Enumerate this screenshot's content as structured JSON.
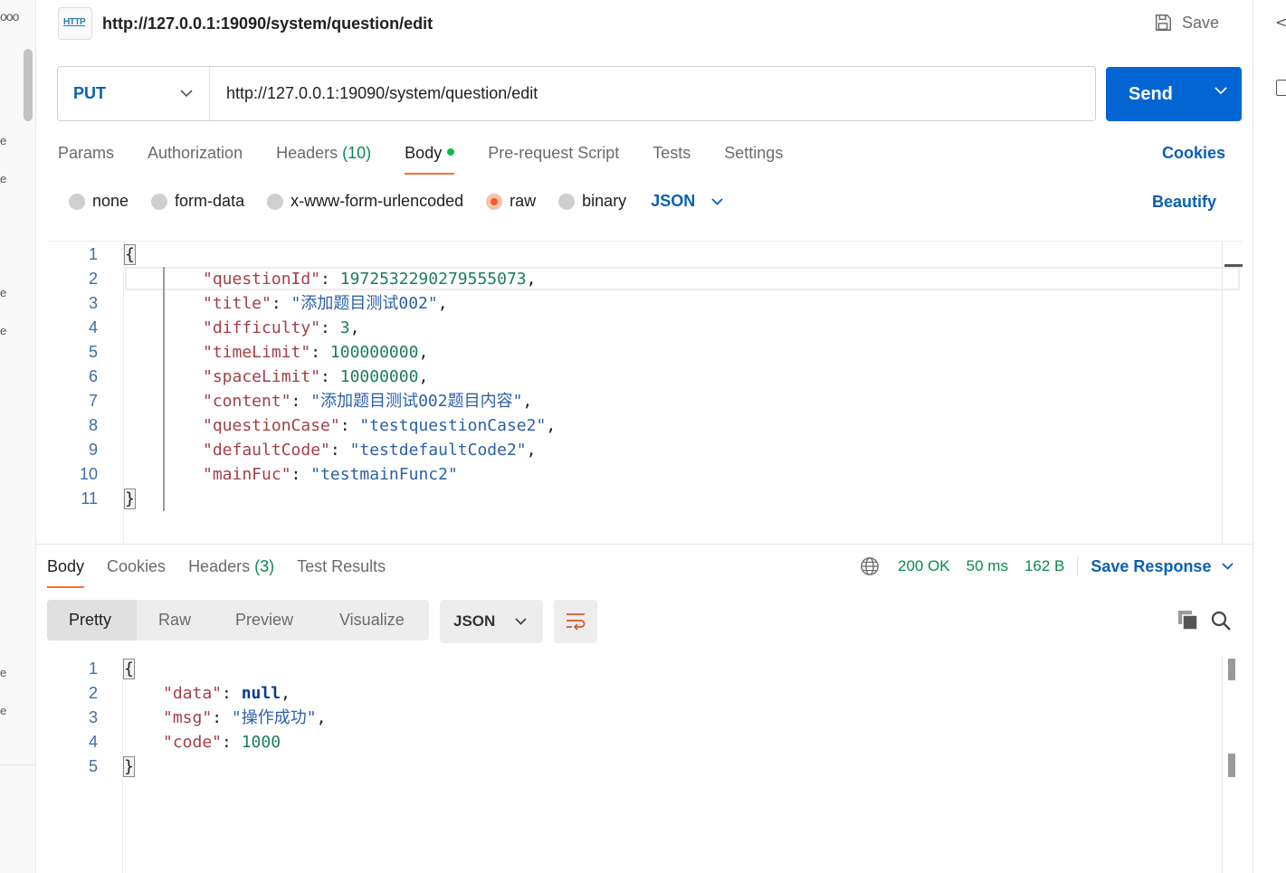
{
  "header": {
    "badge": "HTTP",
    "title": "http://127.0.0.1:19090/system/question/edit",
    "save_label": "Save"
  },
  "request": {
    "method": "PUT",
    "url": "http://127.0.0.1:19090/system/question/edit",
    "send_label": "Send"
  },
  "tabs": {
    "params": "Params",
    "authorization": "Authorization",
    "headers": "Headers",
    "headers_count": "(10)",
    "body": "Body",
    "prerequest": "Pre-request Script",
    "tests": "Tests",
    "settings": "Settings",
    "cookies": "Cookies"
  },
  "body_types": {
    "none": "none",
    "form_data": "form-data",
    "urlencoded": "x-www-form-urlencoded",
    "raw": "raw",
    "binary": "binary",
    "selected": "raw",
    "language": "JSON",
    "beautify": "Beautify"
  },
  "request_body": {
    "line_numbers": [
      "1",
      "2",
      "3",
      "4",
      "5",
      "6",
      "7",
      "8",
      "9",
      "10",
      "11"
    ],
    "open_brace": "{",
    "close_brace": "}",
    "fields": [
      {
        "key": "\"questionId\"",
        "value": "1972532290279555073",
        "kind": "n",
        "comma": ","
      },
      {
        "key": "\"title\"",
        "value": "\"添加题目测试002\"",
        "kind": "s",
        "comma": ","
      },
      {
        "key": "\"difficulty\"",
        "value": "3",
        "kind": "n",
        "comma": ","
      },
      {
        "key": "\"timeLimit\"",
        "value": "100000000",
        "kind": "n",
        "comma": ","
      },
      {
        "key": "\"spaceLimit\"",
        "value": "10000000",
        "kind": "n",
        "comma": ","
      },
      {
        "key": "\"content\"",
        "value": "\"添加题目测试002题目内容\"",
        "kind": "s",
        "comma": ","
      },
      {
        "key": "\"questionCase\"",
        "value": "\"testquestionCase2\"",
        "kind": "s",
        "comma": ","
      },
      {
        "key": "\"defaultCode\"",
        "value": "\"testdefaultCode2\"",
        "kind": "s",
        "comma": ","
      },
      {
        "key": "\"mainFuc\"",
        "value": "\"testmainFunc2\"",
        "kind": "s",
        "comma": ""
      }
    ]
  },
  "response": {
    "tabs": {
      "body": "Body",
      "cookies": "Cookies",
      "headers": "Headers",
      "headers_count": "(3)",
      "test_results": "Test Results"
    },
    "status": "200 OK",
    "time": "50 ms",
    "size": "162 B",
    "save_response": "Save Response",
    "view_tabs": {
      "pretty": "Pretty",
      "raw": "Raw",
      "preview": "Preview",
      "visualize": "Visualize"
    },
    "format": "JSON",
    "line_numbers": [
      "1",
      "2",
      "3",
      "4",
      "5"
    ],
    "open_brace": "{",
    "close_brace": "}",
    "fields": [
      {
        "key": "\"data\"",
        "value": "null",
        "kind": "kw",
        "comma": ","
      },
      {
        "key": "\"msg\"",
        "value": "\"操作成功\"",
        "kind": "s",
        "comma": ","
      },
      {
        "key": "\"code\"",
        "value": "1000",
        "kind": "n",
        "comma": ""
      }
    ]
  },
  "sidebar_fragments": {
    "dots": "ooo",
    "frag": "e"
  },
  "colors": {
    "accent": "#0265d2",
    "link": "#0a5fb4",
    "active_tab": "#ff6c37",
    "status_ok": "#0b8a4e"
  }
}
